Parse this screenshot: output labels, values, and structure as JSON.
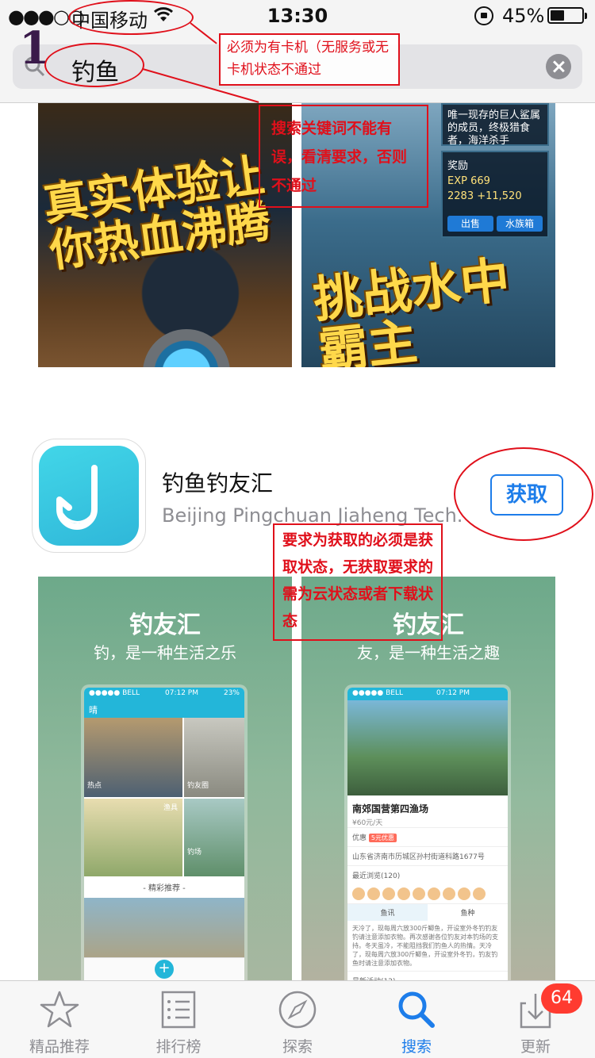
{
  "status_bar": {
    "signal": "●●●○○",
    "carrier": "中国移动",
    "time": "13:30",
    "battery": "45%",
    "battery_level": 0.45
  },
  "search": {
    "query": "钓鱼",
    "step_number": "1"
  },
  "top_screenshots": {
    "left_title": "真实体验让你热血沸腾",
    "right_title": "挑战水中霸主",
    "panel_text": "唯一现存的巨人鲨属的成员，终极猎食者，海洋杀手",
    "reward_label": "奖励",
    "exp": "EXP 669",
    "coins": "2283 +11,520",
    "sell_button": "出售",
    "aquarium_button": "水族箱"
  },
  "app": {
    "name": "钓鱼钓友汇",
    "developer": "Beijing Pingchuan Jiaheng Tech.",
    "get_label": "获取"
  },
  "promo": {
    "left_title": "钓友汇",
    "left_sub": "钓，是一种生活之乐",
    "right_title": "钓友汇",
    "right_sub": "友，是一种生活之趣",
    "phone_status_left": "●●●●● BELL",
    "phone_status_time": "07:12 PM",
    "phone_status_right": "23%",
    "weather": "晴",
    "tile_hot": "热点",
    "tile_friends": "钓友圈",
    "tile_gear": "渔具",
    "tile_spot": "钓场",
    "recommend": "- 精彩推荐 -",
    "place_name": "南郊国营第四渔场",
    "place_price": "¥60元/天",
    "discount": "优惠",
    "discount_badge": "5元优惠",
    "address": "山东省济南市历城区孙村街道科路1677号",
    "recent_visits": "最近浏览(120)",
    "tab_news": "鱼讯",
    "tab_species": "鱼种",
    "description": "天冷了，现每周六放300斤鲫鱼，开设室外冬钓钓友钓请注意添加衣物。再次感谢各位钓友对本钓场的支持。冬天虽冷，不能阻挡我们钓鱼人的热情。天冷了，现每周六放300斤鲫鱼，开设室外冬钓，钓友钓鱼时请注意添加衣物。",
    "latest_activity": "最新活动(12)"
  },
  "annotations": {
    "note_card": "必须为有卡机（无服务或无卡机状态不通过",
    "note_keyword": "搜索关键词不能有误，看清要求，否则不通过",
    "note_get": "要求为获取的必须是获取状态，无获取要求的需为云状态或者下载状态"
  },
  "tabbar": {
    "items": [
      {
        "label": "精品推荐",
        "icon": "star-icon",
        "active": false
      },
      {
        "label": "排行榜",
        "icon": "list-icon",
        "active": false
      },
      {
        "label": "探索",
        "icon": "compass-icon",
        "active": false
      },
      {
        "label": "搜索",
        "icon": "search-icon",
        "active": true
      },
      {
        "label": "更新",
        "icon": "download-icon",
        "active": false
      }
    ],
    "update_badge": "64"
  },
  "colors": {
    "accent": "#1d7dea",
    "annotation": "#e0101b",
    "badge": "#ff3b30",
    "app_icon": "#2fb7d9"
  }
}
